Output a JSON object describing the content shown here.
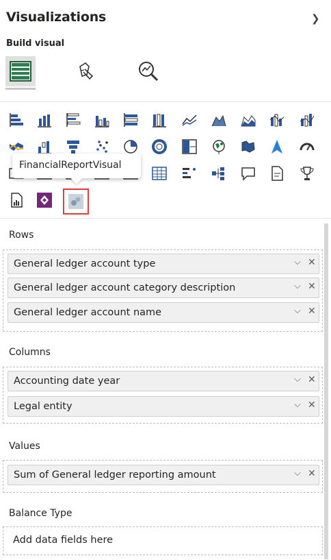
{
  "pane": {
    "title": "Visualizations",
    "build_visual_label": "Build visual"
  },
  "tabs": [
    {
      "name": "build-visual-tab",
      "icon": "table-grid-icon",
      "active": true
    },
    {
      "name": "format-visual-tab",
      "icon": "paintbrush-page-icon",
      "active": false
    },
    {
      "name": "analytics-tab",
      "icon": "magnifier-chart-icon",
      "active": false
    }
  ],
  "tooltip": {
    "text": "FinancialReportVisual"
  },
  "visual_icons": [
    "stacked-bar-chart-icon",
    "stacked-column-chart-icon",
    "clustered-bar-chart-icon",
    "clustered-column-chart-icon",
    "100-stacked-bar-chart-icon",
    "100-stacked-column-chart-icon",
    "line-chart-icon",
    "area-chart-icon",
    "stacked-area-chart-icon",
    "line-and-stacked-column-chart-icon",
    "line-and-clustered-column-chart-icon",
    "ribbon-chart-icon",
    "waterfall-chart-icon",
    "funnel-chart-icon",
    "scatter-chart-icon",
    "pie-chart-icon",
    "donut-chart-icon",
    "treemap-icon",
    "map-icon",
    "filled-map-icon",
    "azure-map-icon",
    "gauge-icon",
    "card-icon",
    "multi-row-card-icon",
    "kpi-icon",
    "slicer-icon",
    "table-icon",
    "matrix-icon",
    "decomposition-tree-icon",
    "key-influencers-icon",
    "qa-icon",
    "smart-narrative-icon",
    "trophy-goals-icon",
    "paginated-report-icon",
    "power-apps-icon",
    "financial-report-visual-icon"
  ],
  "wells": {
    "rows": {
      "label": "Rows",
      "fields": [
        "General ledger account type",
        "General ledger account category description",
        "General ledger account name"
      ]
    },
    "columns": {
      "label": "Columns",
      "fields": [
        "Accounting date year",
        "Legal entity"
      ]
    },
    "values": {
      "label": "Values",
      "fields": [
        "Sum of General ledger reporting amount"
      ]
    },
    "balance_type": {
      "label": "Balance Type",
      "placeholder": "Add data fields here"
    }
  },
  "colors": {
    "accent_green": "#1f7a3e",
    "selection_red": "#e03c3c",
    "icon_blue": "#2b579a",
    "power_apps_purple": "#742774"
  }
}
